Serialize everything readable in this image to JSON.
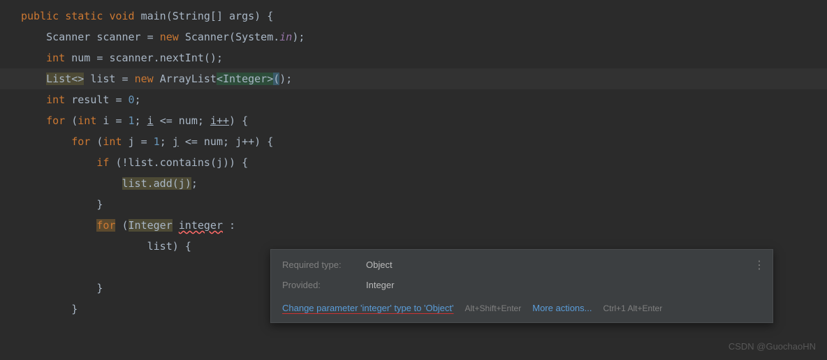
{
  "code": {
    "line1": {
      "kw_public": "public",
      "kw_static": "static",
      "kw_void": "void",
      "method": "main",
      "param_type": "String[]",
      "param_name": "args"
    },
    "line2": {
      "type": "Scanner",
      "var": "scanner",
      "kw_new": "new",
      "clazz": "Scanner",
      "sys": "System",
      "in": "in"
    },
    "line3": {
      "kw_int": "int",
      "var": "num",
      "obj": "scanner",
      "method": "nextInt"
    },
    "line4": {
      "list": "List",
      "diamond": "<>",
      "var": "list",
      "kw_new": "new",
      "clazz": "ArrayList",
      "generic": "<Integer>"
    },
    "line5": {
      "kw_int": "int",
      "var": "result",
      "val": "0"
    },
    "line6": {
      "kw_for": "for",
      "kw_int": "int",
      "var": "i",
      "init": "1",
      "cond_var": "i",
      "cond_op": "<=",
      "cond_limit": "num",
      "inc": "i++"
    },
    "line7": {
      "kw_for": "for",
      "kw_int": "int",
      "var": "j",
      "init": "1",
      "cond_var": "j",
      "cond_op": "<=",
      "cond_limit": "num",
      "inc": "j++"
    },
    "line8": {
      "kw_if": "if",
      "bang": "!",
      "obj": "list",
      "method": "contains",
      "arg": "j"
    },
    "line9": {
      "obj": "list",
      "method": "add",
      "arg": "j"
    },
    "line10": "}",
    "line11": {
      "kw_for": "for",
      "type": "Integer",
      "var": "integer",
      "colon": ":"
    },
    "line12": {
      "obj": "list",
      "brace": "{"
    },
    "line14": "}",
    "line15": "}"
  },
  "tooltip": {
    "required_label": "Required type:",
    "required_value": "Object",
    "provided_label": "Provided:",
    "provided_value": "Integer",
    "action1": "Change parameter 'integer' type to 'Object'",
    "shortcut1": "Alt+Shift+Enter",
    "action2": "More actions...",
    "shortcut2": "Ctrl+1 Alt+Enter",
    "more_icon": "⋮"
  },
  "watermark": "CSDN @GuochaoHN"
}
